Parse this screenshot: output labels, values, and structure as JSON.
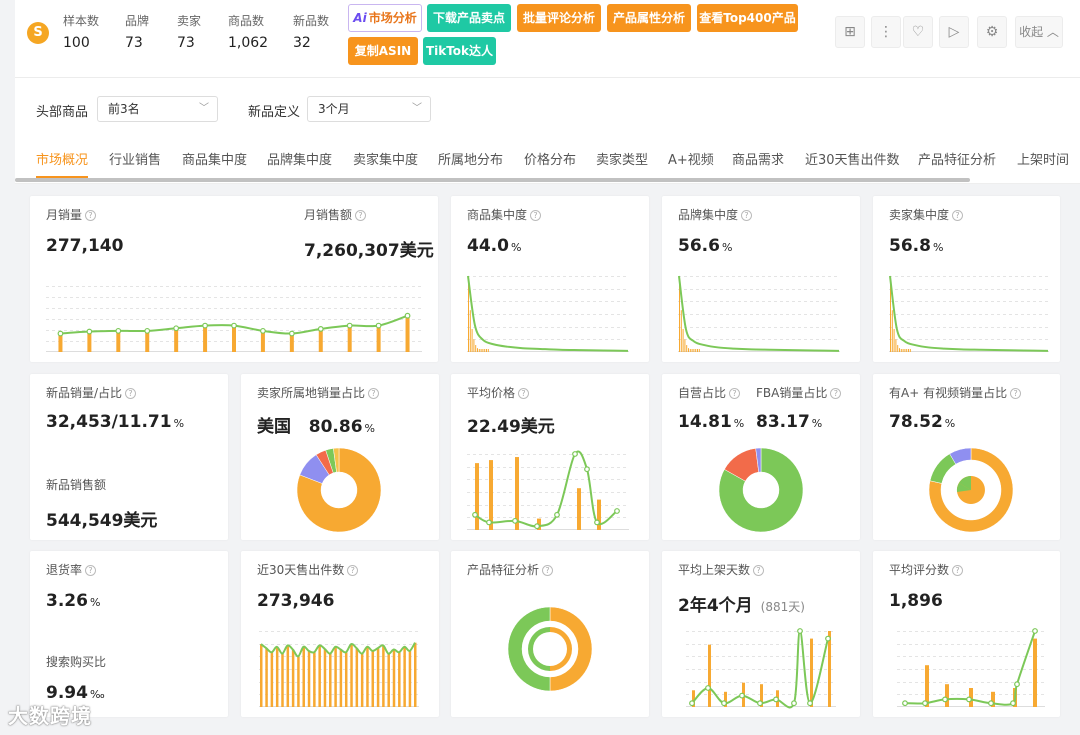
{
  "header": {
    "stats": [
      {
        "label": "样本数",
        "value": "100"
      },
      {
        "label": "品牌",
        "value": "73"
      },
      {
        "label": "卖家",
        "value": "73"
      },
      {
        "label": "商品数",
        "value": "1,062"
      },
      {
        "label": "新品数",
        "value": "32"
      }
    ],
    "buttons": {
      "ai_mark": "Ai",
      "market_analysis": "市场分析",
      "download_selling_points": "下载产品卖点",
      "batch_review_analysis": "批量评论分析",
      "product_attr_analysis": "产品属性分析",
      "view_top400": "查看Top400产品",
      "copy_asin": "复制ASIN",
      "tiktok_influencer": "TikTok达人"
    },
    "tools": {
      "collapse": "收起"
    }
  },
  "filters": {
    "top_products_label": "头部商品",
    "top_products_value": "前3名",
    "new_def_label": "新品定义",
    "new_def_value": "3个月"
  },
  "tabs": [
    "市场概况",
    "行业销售",
    "商品集中度",
    "品牌集中度",
    "卖家集中度",
    "所属地分布",
    "价格分布",
    "卖家类型",
    "A+视频",
    "商品需求",
    "近30天售出件数",
    "产品特征分析",
    "上架时间"
  ],
  "cards": {
    "monthly_sales": {
      "label": "月销量",
      "value": "277,140"
    },
    "monthly_revenue": {
      "label": "月销售额",
      "value": "7,260,307美元"
    },
    "product_conc": {
      "label": "商品集中度",
      "value": "44.0",
      "unit": "%"
    },
    "brand_conc": {
      "label": "品牌集中度",
      "value": "56.6",
      "unit": "%"
    },
    "seller_conc": {
      "label": "卖家集中度",
      "value": "56.8",
      "unit": "%"
    },
    "new_sales": {
      "label": "新品销量/占比",
      "value": "32,453/11.71",
      "unit": "%"
    },
    "new_revenue": {
      "label": "新品销售额",
      "value": "544,549美元"
    },
    "seller_location": {
      "label": "卖家所属地销量占比",
      "country": "美国",
      "value": "80.86",
      "unit": "%"
    },
    "avg_price": {
      "label": "平均价格",
      "value": "22.49美元"
    },
    "self_operated": {
      "label": "自营占比",
      "value": "14.81",
      "unit": "%"
    },
    "fba_sales": {
      "label": "FBA销量占比",
      "value": "83.17",
      "unit": "%"
    },
    "aplus_video": {
      "label": "有A+ 有视频销量占比",
      "value": "78.52",
      "unit": "%"
    },
    "return_rate": {
      "label": "退货率",
      "value": "3.26",
      "unit": "%"
    },
    "search_buy": {
      "label": "搜索购买比",
      "value": "9.94",
      "unit": "‰"
    },
    "sold_30d": {
      "label": "近30天售出件数",
      "value": "273,946"
    },
    "product_features": {
      "label": "产品特征分析"
    },
    "avg_listing_days": {
      "label": "平均上架天数",
      "value": "2年4个月",
      "sub": "(881天)"
    },
    "avg_rating_count": {
      "label": "平均评分数",
      "value": "1,896"
    }
  },
  "colors": {
    "orange": "#f7a932",
    "green": "#7cc858",
    "accent": "#f7941d",
    "teal": "#1fc9a4",
    "purple": "#8f8ff0",
    "red": "#f26b4a"
  },
  "watermark": "大数跨境",
  "chart_data": [
    {
      "type": "bar",
      "title": "月销量",
      "series": [
        {
          "name": "月销量",
          "values": [
            0.28,
            0.31,
            0.32,
            0.32,
            0.36,
            0.4,
            0.4,
            0.32,
            0.28,
            0.35,
            0.4,
            0.4,
            0.55
          ]
        },
        {
          "name": "月销售额",
          "values": [
            0.28,
            0.31,
            0.32,
            0.32,
            0.36,
            0.4,
            0.4,
            0.32,
            0.28,
            0.35,
            0.4,
            0.4,
            0.55
          ]
        }
      ]
    },
    {
      "type": "area",
      "title": "商品集中度",
      "values": [
        1,
        0.35,
        0.16,
        0.1,
        0.07,
        0.05,
        0.04,
        0.03,
        0.025,
        0.02,
        0.015
      ]
    },
    {
      "type": "area",
      "title": "品牌集中度",
      "values": [
        1,
        0.3,
        0.14,
        0.09,
        0.06,
        0.045,
        0.035,
        0.03,
        0.025,
        0.02,
        0.015
      ]
    },
    {
      "type": "area",
      "title": "卖家集中度",
      "values": [
        1,
        0.3,
        0.14,
        0.09,
        0.06,
        0.045,
        0.035,
        0.03,
        0.025,
        0.02,
        0.015
      ]
    },
    {
      "type": "pie",
      "title": "卖家所属地销量占比",
      "values": [
        80.86,
        10,
        4,
        3,
        2.14
      ]
    },
    {
      "type": "bar",
      "title": "平均价格",
      "bars": [
        0.88,
        0.92,
        0.96,
        0.15,
        0.55,
        0.4
      ],
      "line": [
        0.2,
        0.1,
        0.12,
        0.05,
        0.2,
        1.0,
        0.8,
        0.1,
        0.25
      ]
    },
    {
      "type": "pie",
      "title": "自营占比",
      "values": [
        83.17,
        14.81,
        2.02
      ]
    },
    {
      "type": "pie",
      "title": "有A+ 有视频销量占比",
      "values": [
        78.52,
        13,
        8.48
      ]
    },
    {
      "type": "bar",
      "title": "近30天售出件数",
      "values": [
        0.92,
        0.86,
        0.8,
        0.88,
        0.78,
        0.9,
        0.84,
        0.74,
        0.88,
        0.82,
        0.8,
        0.9,
        0.85,
        0.78,
        0.88,
        0.84,
        0.8,
        0.92,
        0.86,
        0.78,
        0.88,
        0.82,
        0.86,
        0.9,
        0.78,
        0.84,
        0.8,
        0.88,
        0.82,
        0.94
      ]
    },
    {
      "type": "pie",
      "title": "产品特征分析",
      "values": [
        50,
        50
      ]
    },
    {
      "type": "bar",
      "title": "平均上架天数",
      "bars": [
        0.22,
        0.82,
        0.2,
        0.32,
        0.3,
        0.22,
        0.9,
        1.0
      ],
      "line": [
        0.05,
        0.25,
        0.05,
        0.15,
        0.05,
        0.1,
        0.05,
        1.0,
        0.05,
        0.9
      ]
    },
    {
      "type": "bar",
      "title": "平均评分数",
      "bars": [
        0.55,
        0.3,
        0.25,
        0.2,
        0.25,
        0.9
      ],
      "line": [
        0.05,
        0.05,
        0.1,
        0.1,
        0.05,
        0.05,
        0.3,
        1.0
      ]
    }
  ]
}
